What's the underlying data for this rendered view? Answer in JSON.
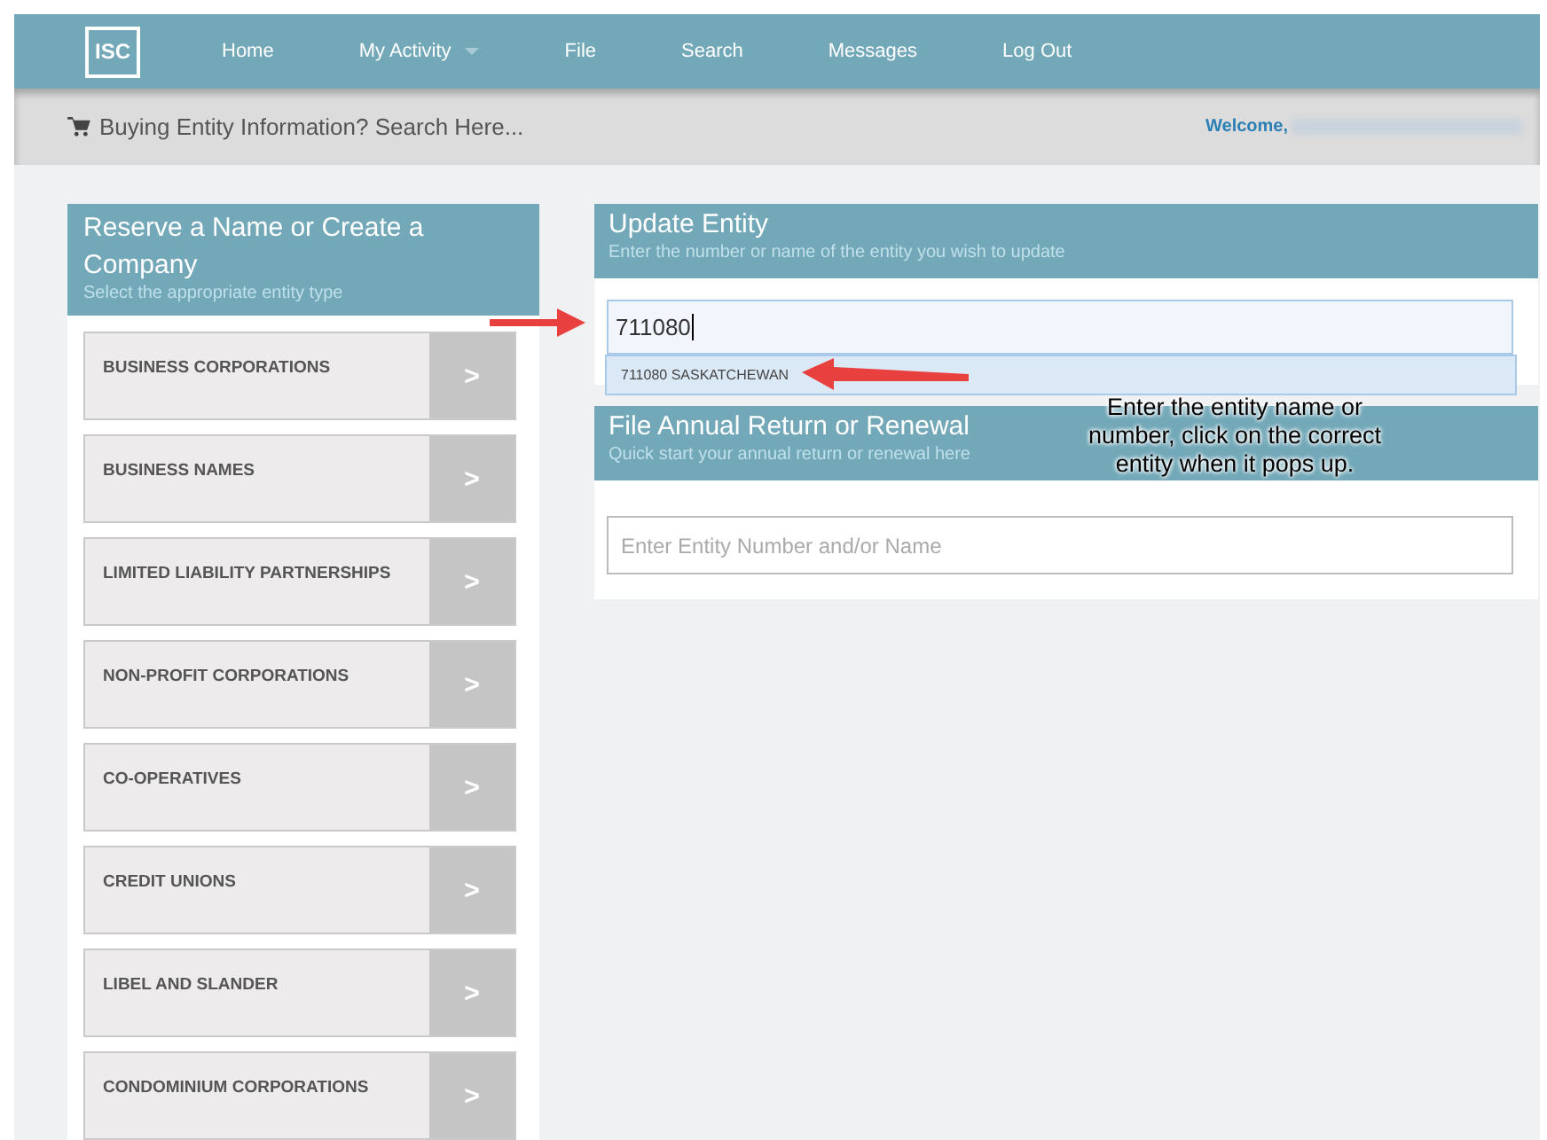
{
  "nav": {
    "logo": "ISC",
    "items": [
      {
        "label": "Home",
        "has_menu": false
      },
      {
        "label": "My Activity",
        "has_menu": true
      },
      {
        "label": "File",
        "has_menu": false
      },
      {
        "label": "Search",
        "has_menu": false
      },
      {
        "label": "Messages",
        "has_menu": false
      },
      {
        "label": "Log Out",
        "has_menu": false
      }
    ]
  },
  "subbar": {
    "search_link": "Buying Entity Information? Search Here...",
    "welcome": "Welcome,"
  },
  "reserve_panel": {
    "title": "Reserve a Name or Create a Company",
    "subtitle": "Select the appropriate entity type",
    "items": [
      {
        "label": "BUSINESS CORPORATIONS",
        "arrow": ">"
      },
      {
        "label": "BUSINESS NAMES",
        "arrow": ">"
      },
      {
        "label": "LIMITED LIABILITY PARTNERSHIPS",
        "arrow": ">"
      },
      {
        "label": "NON-PROFIT CORPORATIONS",
        "arrow": ">"
      },
      {
        "label": "CO-OPERATIVES",
        "arrow": ">"
      },
      {
        "label": "CREDIT UNIONS",
        "arrow": ">"
      },
      {
        "label": "LIBEL AND SLANDER",
        "arrow": ">"
      },
      {
        "label": "CONDOMINIUM CORPORATIONS",
        "arrow": ">"
      }
    ]
  },
  "update_panel": {
    "title": "Update Entity",
    "subtitle": "Enter the number or name of the entity you wish to update",
    "value": "711080",
    "suggestion": "711080 SASKATCHEWAN"
  },
  "annual_panel": {
    "title": "File Annual Return or Renewal",
    "subtitle": "Quick start your annual return or renewal here",
    "placeholder": "Enter Entity Number and/or Name"
  },
  "callout": "Enter the entity name or number, click on the correct entity when it pops up."
}
